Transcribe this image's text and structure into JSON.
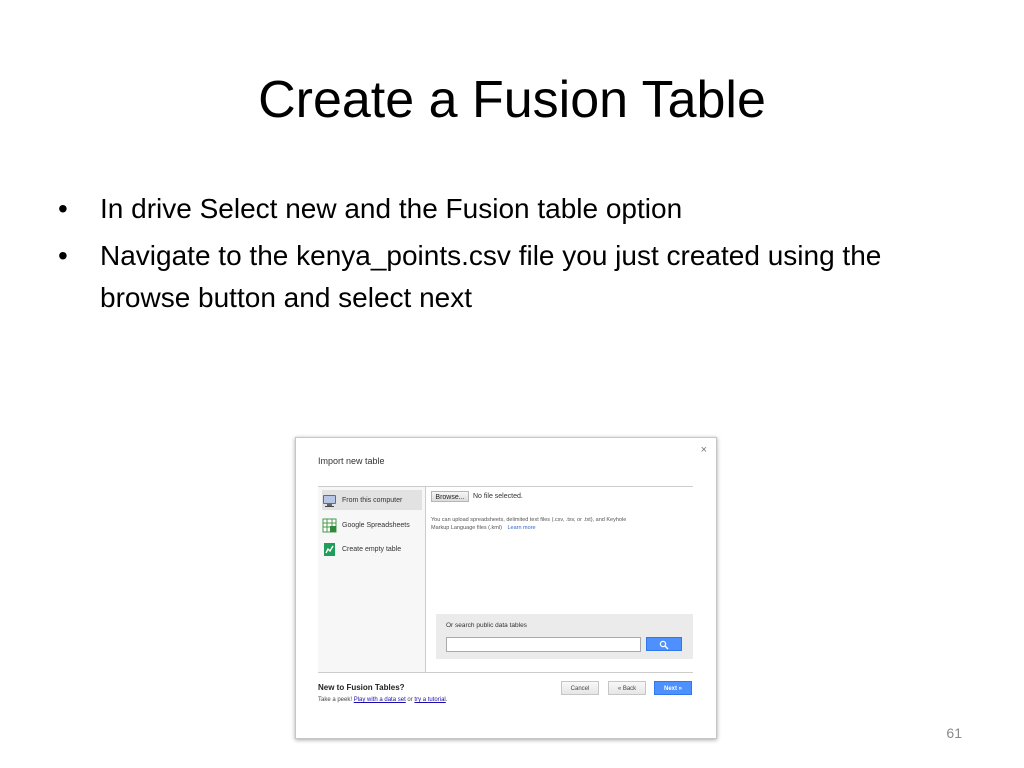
{
  "slide": {
    "title": "Create a Fusion Table",
    "bullets": [
      "In drive Select new and the Fusion table option",
      "Navigate to the kenya_points.csv file you just created using the browse button and select next"
    ],
    "bullet_char": "•",
    "page_number": "61"
  },
  "dialog": {
    "title": "Import new table",
    "close_glyph": "×",
    "nav": [
      {
        "label": "From this computer",
        "icon": "computer-icon"
      },
      {
        "label": "Google Spreadsheets",
        "icon": "spreadsheet-icon"
      },
      {
        "label": "Create empty table",
        "icon": "fusion-table-icon"
      }
    ],
    "browse_label": "Browse...",
    "no_file_text": "No file selected.",
    "upload_info": "You can upload spreadsheets, delimited text files (.csv, .tsv, or .txt), and Keyhole Markup Language files (.kml)",
    "learn_more": "Learn more",
    "search_label": "Or search public data tables",
    "search_value": "",
    "search_icon": "search-icon",
    "new_title": "New to Fusion Tables?",
    "peek_prefix": "Take a peek!",
    "peek_link1": "Play with a data set",
    "peek_or": "or",
    "peek_link2": "try a tutorial",
    "peek_end": ".",
    "cancel_label": "Cancel",
    "back_label": "« Back",
    "next_label": "Next »"
  },
  "colors": {
    "accent_blue": "#4d90fe",
    "link_blue": "#1a0dab"
  }
}
